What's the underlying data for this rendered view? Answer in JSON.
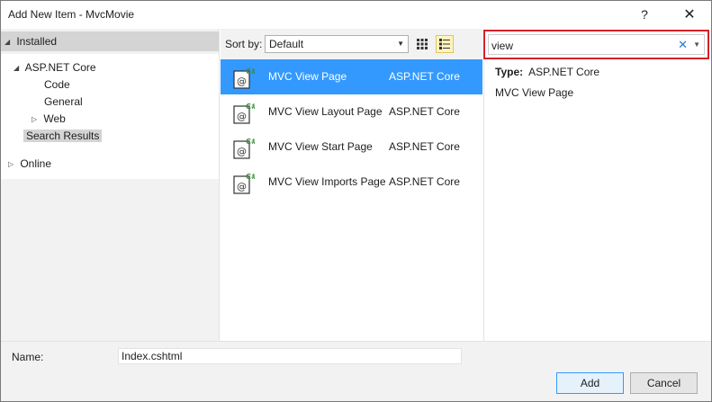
{
  "window": {
    "title": "Add New Item - MvcMovie",
    "help_label": "?",
    "close_label": "✕"
  },
  "sidebar": {
    "installed_label": "Installed",
    "aspnet_label": "ASP.NET Core",
    "children": [
      {
        "label": "Code"
      },
      {
        "label": "General"
      },
      {
        "label": "Web"
      },
      {
        "label": "Search Results"
      }
    ],
    "online_label": "Online"
  },
  "sort": {
    "label": "Sort by:",
    "selected": "Default"
  },
  "items": [
    {
      "name": "MVC View Page",
      "type": "ASP.NET Core",
      "selected": true
    },
    {
      "name": "MVC View Layout Page",
      "type": "ASP.NET Core",
      "selected": false
    },
    {
      "name": "MVC View Start Page",
      "type": "ASP.NET Core",
      "selected": false
    },
    {
      "name": "MVC View Imports Page",
      "type": "ASP.NET Core",
      "selected": false
    }
  ],
  "search": {
    "value": "view",
    "clear_label": "✕"
  },
  "details": {
    "type_label": "Type:",
    "type_value": "ASP.NET Core",
    "description": "MVC View Page"
  },
  "bottom": {
    "name_label": "Name:",
    "name_value": "Index.cshtml",
    "add_label": "Add",
    "cancel_label": "Cancel"
  },
  "colors": {
    "selection": "#3399ff",
    "search_highlight": "#d4202a",
    "panel_gray": "#f2f2f2"
  }
}
